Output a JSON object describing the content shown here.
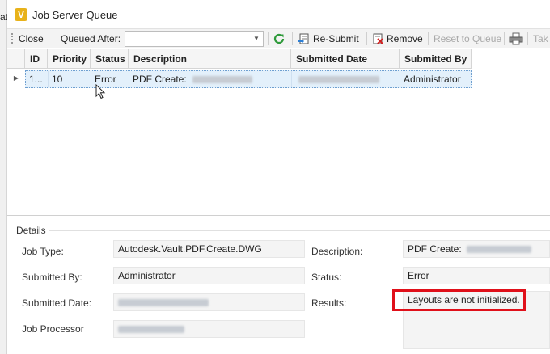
{
  "left_edge_text": "at",
  "window": {
    "title": "Job Server Queue"
  },
  "toolbar": {
    "close_label": "Close",
    "queued_after_label": "Queued After:",
    "queued_after_value": "",
    "resubmit_label": "Re-Submit",
    "remove_label": "Remove",
    "reset_label": "Reset to Queue",
    "take_label": "Tak"
  },
  "grid": {
    "columns": [
      "ID",
      "Priority",
      "Status",
      "Description",
      "Submitted Date",
      "Submitted By"
    ],
    "rows": [
      {
        "id": "1...",
        "priority": "10",
        "status": "Error",
        "description_prefix": "PDF Create:",
        "submitted_date": "",
        "submitted_by": "Administrator"
      }
    ]
  },
  "details": {
    "section_title": "Details",
    "job_type_label": "Job Type:",
    "job_type_value": "Autodesk.Vault.PDF.Create.DWG",
    "submitted_by_label": "Submitted By:",
    "submitted_by_value": "Administrator",
    "submitted_date_label": "Submitted Date:",
    "job_processor_label": "Job Processor",
    "description_label": "Description:",
    "description_prefix": "PDF Create:",
    "status_label": "Status:",
    "status_value": "Error",
    "results_label": "Results:",
    "results_value": "Layouts are not initialized."
  },
  "colors": {
    "selection_row": "#e3f0fb",
    "highlight_box": "#e0101a",
    "app_icon": "#e8b21a",
    "refresh_icon": "#2e9a3a"
  }
}
